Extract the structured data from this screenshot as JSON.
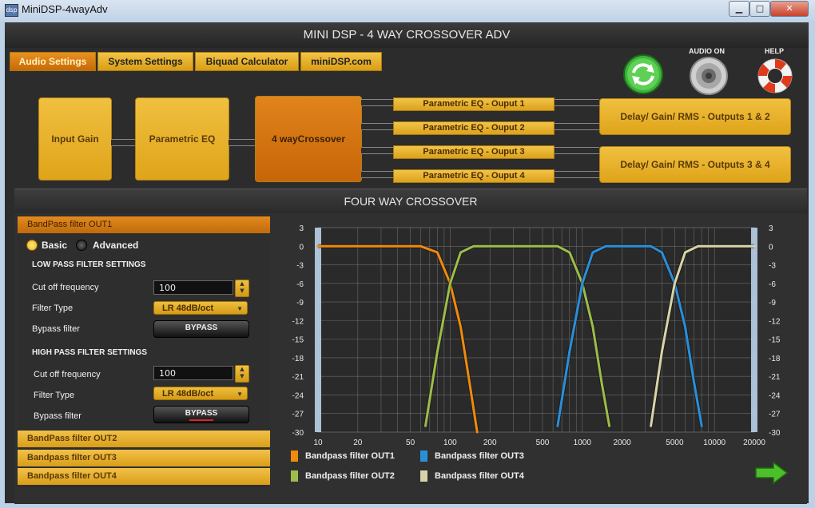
{
  "window": {
    "title": "MiniDSP-4wayAdv",
    "icon_text": "dsp",
    "min_glyph": "▁",
    "max_glyph": "□",
    "close_glyph": "✕"
  },
  "header": {
    "title": "MINI DSP - 4 WAY CROSSOVER ADV"
  },
  "tabs": [
    {
      "label": "Audio Settings",
      "active": true
    },
    {
      "label": "System Settings"
    },
    {
      "label": "Biquad Calculator"
    },
    {
      "label": "miniDSP.com"
    }
  ],
  "top_icons": {
    "refresh": {
      "label": ""
    },
    "audio": {
      "label": "AUDIO ON"
    },
    "help": {
      "label": "HELP"
    }
  },
  "flow": {
    "input_gain": "Input Gain",
    "parametric_eq": "Parametric EQ",
    "crossover": "4 wayCrossover",
    "out_eq": [
      "Parametric EQ - Ouput 1",
      "Parametric EQ - Ouput 2",
      "Parametric EQ - Ouput 3",
      "Parametric EQ - Ouput 4"
    ],
    "delay_12": "Delay/ Gain/ RMS - Outputs 1 & 2",
    "delay_34": "Delay/ Gain/ RMS - Outputs 3 & 4"
  },
  "crossover_section": {
    "title": "FOUR WAY CROSSOVER",
    "open_filter": "BandPass filter OUT1",
    "mode_basic": "Basic",
    "mode_advanced": "Advanced",
    "low_pass": {
      "heading": "LOW PASS FILTER SETTINGS",
      "cutoff_label": "Cut off frequency",
      "cutoff_value": "100",
      "type_label": "Filter Type",
      "type_value": "LR 48dB/oct",
      "bypass_label": "Bypass filter",
      "bypass_button": "BYPASS"
    },
    "high_pass": {
      "heading": "HIGH PASS FILTER SETTINGS",
      "cutoff_label": "Cut off frequency",
      "cutoff_value": "100",
      "type_label": "Filter Type",
      "type_value": "LR 48dB/oct",
      "bypass_label": "Bypass filter",
      "bypass_button": "BYPASS"
    },
    "collapsed_filters": [
      "BandPass filter OUT2",
      "Bandpass filter OUT3",
      "Bandpass filter OUT4"
    ]
  },
  "legend": [
    {
      "label": "Bandpass filter OUT1",
      "color": "#f08a0c"
    },
    {
      "label": "Bandpass filter OUT2",
      "color": "#9cbd4a"
    },
    {
      "label": "Bandpass filter OUT3",
      "color": "#2a8fdb"
    },
    {
      "label": "Bandpass filter OUT4",
      "color": "#d9d4a8"
    }
  ],
  "chart_data": {
    "type": "line",
    "title": "",
    "xlabel": "",
    "ylabel": "",
    "x_scale": "log",
    "xlim": [
      10,
      20000
    ],
    "ylim": [
      -30,
      3
    ],
    "x_ticks": [
      10,
      20,
      50,
      100,
      200,
      500,
      1000,
      2000,
      5000,
      10000,
      20000
    ],
    "y_ticks": [
      3,
      0,
      -3,
      -6,
      -9,
      -12,
      -15,
      -18,
      -21,
      -24,
      -27,
      -30
    ],
    "grid": true,
    "legend_position": "bottom",
    "series": [
      {
        "name": "Bandpass filter OUT1",
        "color": "#f08a0c",
        "highpass_hz": null,
        "lowpass_hz": 100,
        "points": [
          [
            10,
            0
          ],
          [
            60,
            0
          ],
          [
            80,
            -1
          ],
          [
            100,
            -6
          ],
          [
            120,
            -13
          ],
          [
            140,
            -22
          ],
          [
            160,
            -30
          ]
        ]
      },
      {
        "name": "Bandpass filter OUT2",
        "color": "#9cbd4a",
        "highpass_hz": 100,
        "lowpass_hz": 1000,
        "points": [
          [
            65,
            -29
          ],
          [
            80,
            -17
          ],
          [
            100,
            -6
          ],
          [
            120,
            -1
          ],
          [
            150,
            0
          ],
          [
            650,
            0
          ],
          [
            800,
            -1
          ],
          [
            1000,
            -6
          ],
          [
            1200,
            -13
          ],
          [
            1400,
            -22
          ],
          [
            1600,
            -29
          ]
        ]
      },
      {
        "name": "Bandpass filter OUT3",
        "color": "#2a8fdb",
        "highpass_hz": 1000,
        "lowpass_hz": 5000,
        "points": [
          [
            650,
            -29
          ],
          [
            800,
            -17
          ],
          [
            1000,
            -6
          ],
          [
            1200,
            -1
          ],
          [
            1500,
            0
          ],
          [
            3300,
            0
          ],
          [
            4000,
            -1
          ],
          [
            5000,
            -6
          ],
          [
            6000,
            -13
          ],
          [
            7000,
            -22
          ],
          [
            8000,
            -29
          ]
        ]
      },
      {
        "name": "Bandpass filter OUT4",
        "color": "#d9d4a8",
        "highpass_hz": 5000,
        "lowpass_hz": null,
        "points": [
          [
            3300,
            -29
          ],
          [
            4000,
            -17
          ],
          [
            5000,
            -6
          ],
          [
            6000,
            -1
          ],
          [
            7500,
            0
          ],
          [
            20000,
            0
          ]
        ]
      }
    ]
  }
}
